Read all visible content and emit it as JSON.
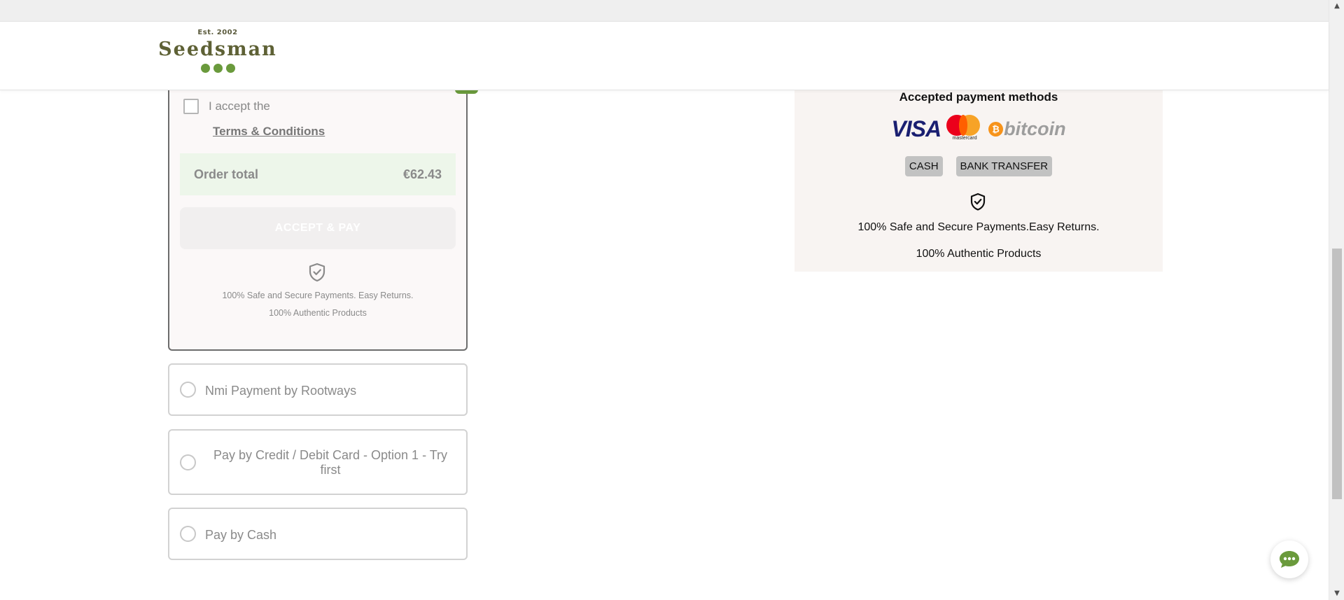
{
  "header": {
    "logo_est": "Est. 2002",
    "logo_name": "Seedsman"
  },
  "selected_payment": {
    "accept_text": "I accept the",
    "terms_link": "Terms & Conditions",
    "order_total_label": "Order total",
    "order_total_value": "€62.43",
    "accept_pay_button": "ACCEPT & PAY",
    "safe_text": "100% Safe and Secure Payments. Easy Returns.",
    "authentic_text": "100% Authentic Products"
  },
  "payment_options": [
    {
      "label": "Nmi Payment by Rootways"
    },
    {
      "label": "Pay by Credit / Debit Card - Option 1 - Try first"
    },
    {
      "label": "Pay by Cash"
    }
  ],
  "accepted_panel": {
    "title": "Accepted payment methods",
    "visa": "VISA",
    "mastercard": "mastercard",
    "bitcoin": "bitcoin",
    "badges": [
      "CASH",
      "BANK TRANSFER"
    ],
    "safe_text": "100% Safe and Secure Payments.Easy Returns.",
    "authentic_text": "100% Authentic Products"
  },
  "colors": {
    "brand_green": "#6a9a3c",
    "brand_olive": "#5e6135",
    "order_total_bg": "#edf6ea",
    "panel_bg": "#f8f4f2"
  },
  "icons": {
    "shield": "shield-check-icon",
    "chat": "chat-bubble-icon",
    "radio": "radio-empty-icon",
    "checkbox": "checkbox-empty-icon"
  }
}
